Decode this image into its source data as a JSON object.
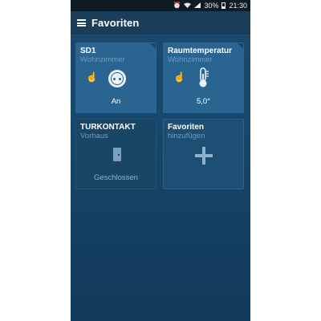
{
  "status_bar": {
    "icons": [
      "alarm-icon",
      "wifi-icon",
      "signal-icon",
      "battery-icon"
    ],
    "battery": "30%",
    "time": "21:30"
  },
  "appbar": {
    "title": "Favoriten",
    "menu_icon": "hamburger-icon"
  },
  "tiles": [
    {
      "title": "SD1",
      "subtitle": "Wohnzimmer",
      "state": "An",
      "icon": "power-socket-icon"
    },
    {
      "title": "Raumtemperatur",
      "subtitle": "Wohnzimmer",
      "state": "5,0°",
      "icon": "thermometer-icon"
    },
    {
      "title": "TURKONTAKT",
      "subtitle": "Vorhaus",
      "state": "Geschlossen",
      "icon": "door-icon"
    },
    {
      "title": "Favoriten",
      "subtitle": "hinzufügen",
      "icon": "plus-icon"
    }
  ],
  "colors": {
    "background": "#17476c",
    "tile": "#245b85",
    "subtitle": "#6f9bbd",
    "statusbar": "#0e1a24"
  }
}
